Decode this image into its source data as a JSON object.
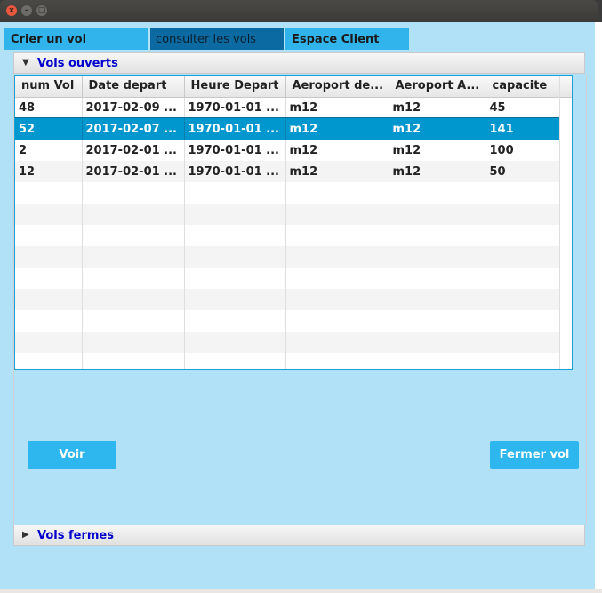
{
  "window": {
    "background_title": "",
    "controls": {
      "close": "x",
      "minimize": "–",
      "maximize": "□"
    }
  },
  "tabs": [
    {
      "label": "Crier un vol"
    },
    {
      "label": "consulter les vols",
      "selected": true
    },
    {
      "label": "Espace Client"
    }
  ],
  "sections": {
    "open": {
      "label": "Vols ouverts",
      "expanded": true
    },
    "closed": {
      "label": "Vols fermes",
      "expanded": false
    }
  },
  "table": {
    "columns": [
      "num Vol",
      "Date depart",
      "Heure Depart",
      "Aeroport de...",
      "Aeroport A...",
      "capacite"
    ],
    "rows": [
      [
        "48",
        "2017-02-09 ...",
        "1970-01-01 ...",
        "m12",
        "m12",
        "45"
      ],
      [
        "52",
        "2017-02-07 ...",
        "1970-01-01 ...",
        "m12",
        "m12",
        "141"
      ],
      [
        "2",
        "2017-02-01 ...",
        "1970-01-01 ...",
        "m12",
        "m12",
        "100"
      ],
      [
        "12",
        "2017-02-01 ...",
        "1970-01-01 ...",
        "m12",
        "m12",
        "50"
      ]
    ],
    "selected_row": 1,
    "empty_rows": 9
  },
  "buttons": {
    "voir": "Voir",
    "fermer": "Fermer vol"
  },
  "colors": {
    "window_bg": "#b0e1f6",
    "tab_active": "#0b6aa2",
    "tab_inactive": "#31b4ec",
    "button": "#2eb6ef",
    "selection": "#0097cf",
    "section_label": "#0000cc"
  }
}
